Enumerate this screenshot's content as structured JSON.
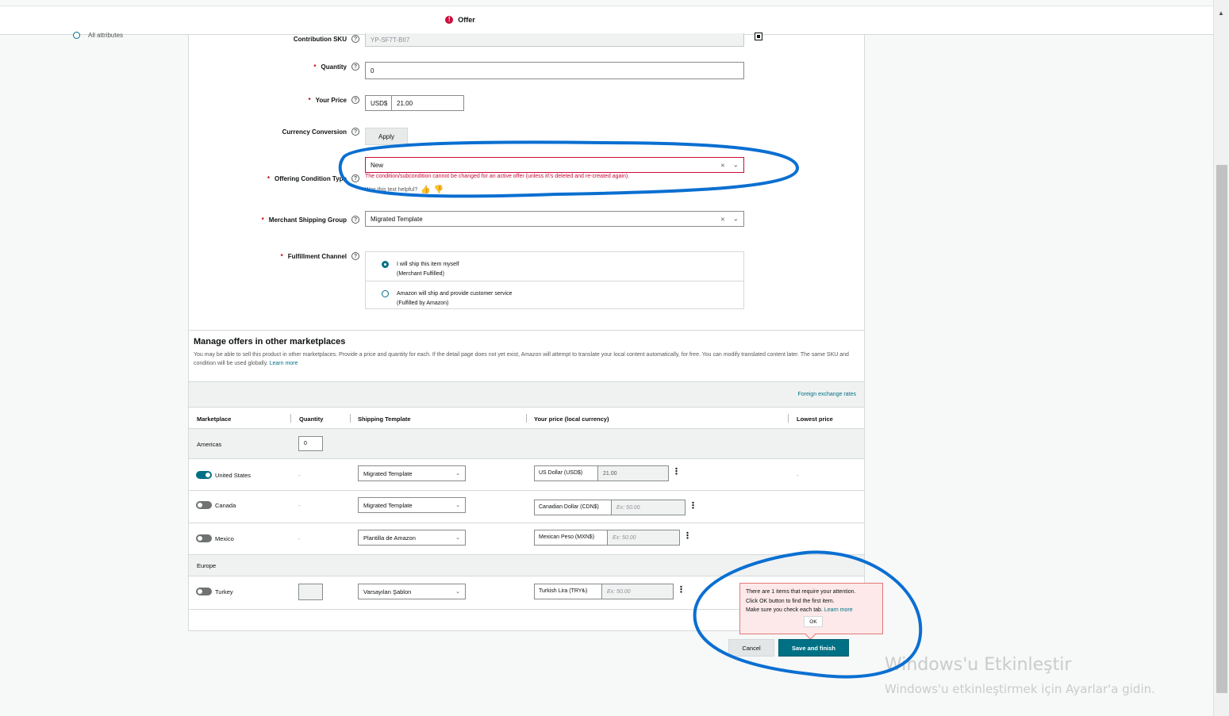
{
  "header": {
    "tab_offer": "Offer",
    "tab_offer_alert": "!"
  },
  "sidebar": {
    "all_attributes": "All attributes"
  },
  "form": {
    "contribution_sku": {
      "label": "Contribution SKU",
      "value": "YP-SF7T-BII7"
    },
    "quantity": {
      "label": "Quantity",
      "value": "0"
    },
    "your_price": {
      "label": "Your Price",
      "currency": "USD$",
      "value": "21.00"
    },
    "currency_conversion": {
      "label": "Currency Conversion",
      "button": "Apply"
    },
    "offering_condition": {
      "label": "Offering Condition Type",
      "value": "New",
      "clear": "×",
      "error": "The condition/subcondition cannot be changed for an active offer (unless it\\'s deleted and re-created again).",
      "helpful_prompt": "Was this text helpful?"
    },
    "merchant_shipping": {
      "label": "Merchant Shipping Group",
      "value": "Migrated Template",
      "clear": "×"
    },
    "fulfillment": {
      "label": "Fulfillment Channel",
      "options": [
        {
          "line1": "I will ship this item myself",
          "line2": "(Merchant Fulfilled)",
          "selected": true
        },
        {
          "line1": "Amazon will ship and provide customer service",
          "line2": "(Fulfilled by Amazon)",
          "selected": false
        }
      ]
    },
    "help_glyph": "?",
    "required_glyph": "*"
  },
  "marketplaces": {
    "title": "Manage offers in other marketplaces",
    "description": "You may be able to sell this product in other marketplaces. Provide a price and quantity for each. If the detail page does not yet exist, Amazon will attempt to translate your local content automatically, for free. You can modify translated content later. The same SKU and condition will be used globally.",
    "learn_more": "Learn more",
    "fx_rates": "Foreign exchange rates",
    "columns": [
      "Marketplace",
      "Quantity",
      "Shipping Template",
      "Your price (local currency)",
      "Lowest price"
    ],
    "groups": {
      "americas": {
        "name": "Americas",
        "quantity": "0"
      },
      "europe": {
        "name": "Europe"
      }
    },
    "rows": [
      {
        "name": "United States",
        "enabled": true,
        "qty": "-",
        "template": "Migrated Template",
        "currency": "US Dollar (USD$)",
        "price": "21.00",
        "lowest": "-"
      },
      {
        "name": "Canada",
        "enabled": false,
        "qty": "-",
        "template": "Migrated Template",
        "currency": "Canadian Dollar (CDN$)",
        "price": "Ex: 50.00",
        "lowest": ""
      },
      {
        "name": "Mexico",
        "enabled": false,
        "qty": "-",
        "template": "Plantilla de Amazon",
        "currency": "Mexican Peso (MXN$)",
        "price": "Ex: 50.00",
        "lowest": ""
      },
      {
        "name": "Turkey",
        "enabled": false,
        "qty": "",
        "template": "Varsayılan Şablon",
        "currency": "Turkish Lira (TRY₺)",
        "price": "Ex: 50.00",
        "lowest": ""
      }
    ]
  },
  "alert_tooltip": {
    "line1": "There are 1 items that require your attention.",
    "line2": "Click OK button to find the first item.",
    "line3": "Make sure you check each tab.",
    "learn_more": "Learn more",
    "ok": "OK"
  },
  "actions": {
    "cancel": "Cancel",
    "save": "Save and finish"
  },
  "watermark": {
    "title": "Windows'u Etkinleştir",
    "subtitle": "Windows'u etkinleştirmek için Ayarlar'a gidin."
  },
  "annotations": {
    "color": "#0a6fd1"
  }
}
